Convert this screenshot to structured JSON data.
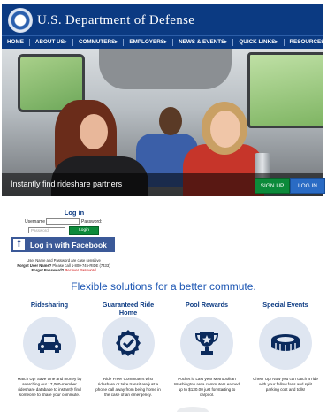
{
  "header": {
    "title": "U.S. Department of Defense"
  },
  "nav": {
    "items": [
      "HOME",
      "ABOUT US▸",
      "COMMUTERS▸",
      "EMPLOYERS▸",
      "NEWS & EVENTS▸",
      "QUICK LINKS▸",
      "RESOURCES▸"
    ]
  },
  "hero": {
    "caption": "Instantly find rideshare partners",
    "signup_label": "SIGN UP",
    "login_label": "LOG IN"
  },
  "login": {
    "title": "Log in",
    "username_label": "Username",
    "password_label": "Password:",
    "password_placeholder": "Password",
    "login_button": "Login",
    "facebook_button": "Log in with Facebook",
    "notice_case": "User Name and Password are case sensitive",
    "forgot_username_label": "Forgot User Name?",
    "forgot_username_text": "Please call 1-800-745-RIDE (7433)",
    "forgot_password_label": "Forgot Password?",
    "forgot_password_link": "Recover Password"
  },
  "tagline": "Flexible solutions for a better commute.",
  "features": [
    {
      "title": "Ridesharing",
      "icon": "car-icon",
      "desc": "Match Up! Save time and money by searching our 17,000-member rideshare database to instantly find someone to share your commute."
    },
    {
      "title": "Guaranteed Ride Home",
      "icon": "checkmark-badge-icon",
      "desc": "Ride Free! Commuters who rideshare or take transit are just a phone call away from being home in the case of an emergency."
    },
    {
      "title": "Pool Rewards",
      "icon": "trophy-icon",
      "desc": "Pocket it! Last year Metropolitan Washington area commuters earned up to $130.00 just for starting to carpool."
    },
    {
      "title": "Special Events",
      "icon": "stadium-icon",
      "desc": "Cheer Up! Now you can catch a ride with your fellow fans and split parking cost and tolls!"
    }
  ],
  "colors": {
    "brand_navy": "#0b3a82",
    "signup_green": "#0c8a3a",
    "login_blue": "#2a6bc4",
    "facebook_blue": "#3b5998",
    "tagline_blue": "#1c56b3"
  }
}
